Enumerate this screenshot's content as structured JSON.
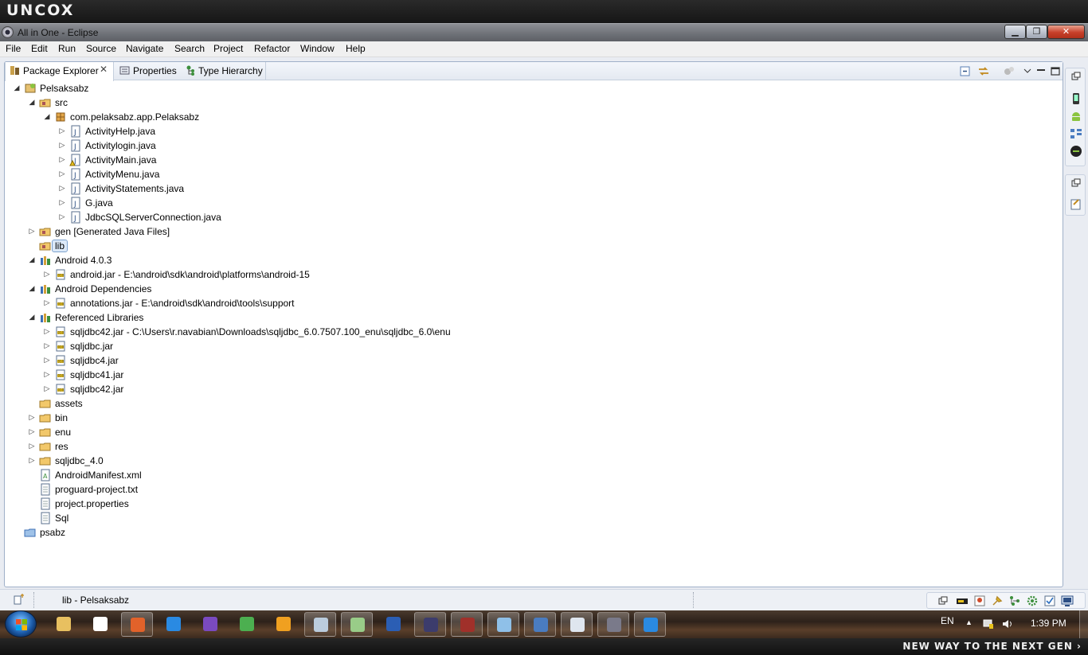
{
  "brand": {
    "logo": "UNCOX",
    "slogan": "NEW WAY TO THE NEXT GEN ›"
  },
  "window": {
    "title": "All in One - Eclipse",
    "controls": {
      "minimize": "▁",
      "maximize": "❐",
      "close": "✕"
    }
  },
  "menu": [
    "File",
    "Edit",
    "Run",
    "Source",
    "Navigate",
    "Search",
    "Project",
    "Refactor",
    "Window",
    "Help"
  ],
  "tabs": {
    "package_explorer": "Package Explorer",
    "close": "✕",
    "properties": "Properties",
    "type_hierarchy": "Type Hierarchy"
  },
  "tree": [
    {
      "label": "Pelsaksabz",
      "twisty": "◢",
      "icon": "android-project-icon"
    },
    {
      "label": "src",
      "twisty": "◢",
      "icon": "source-folder-icon"
    },
    {
      "label": "com.pelaksabz.app.Pelaksabz",
      "twisty": "◢",
      "icon": "package-icon"
    },
    {
      "label": "ActivityHelp.java",
      "twisty": "▷",
      "icon": "java-file-icon"
    },
    {
      "label": "Activitylogin.java",
      "twisty": "▷",
      "icon": "java-file-icon"
    },
    {
      "label": "ActivityMain.java",
      "twisty": "▷",
      "icon": "java-file-warning-icon"
    },
    {
      "label": "ActivityMenu.java",
      "twisty": "▷",
      "icon": "java-file-icon"
    },
    {
      "label": "ActivityStatements.java",
      "twisty": "▷",
      "icon": "java-file-icon"
    },
    {
      "label": "G.java",
      "twisty": "▷",
      "icon": "java-file-icon"
    },
    {
      "label": "JdbcSQLServerConnection.java",
      "twisty": "▷",
      "icon": "java-file-icon"
    },
    {
      "label": "gen [Generated Java Files]",
      "twisty": "▷",
      "icon": "source-folder-icon"
    },
    {
      "label": "lib",
      "twisty": "",
      "icon": "source-folder-icon"
    },
    {
      "label": "Android 4.0.3",
      "twisty": "◢",
      "icon": "library-icon"
    },
    {
      "label": "android.jar - E:\\android\\sdk\\android\\platforms\\android-15",
      "twisty": "▷",
      "icon": "jar-icon"
    },
    {
      "label": "Android Dependencies",
      "twisty": "◢",
      "icon": "library-icon"
    },
    {
      "label": "annotations.jar - E:\\android\\sdk\\android\\tools\\support",
      "twisty": "▷",
      "icon": "jar-icon"
    },
    {
      "label": "Referenced Libraries",
      "twisty": "◢",
      "icon": "library-icon"
    },
    {
      "label": "sqljdbc42.jar - C:\\Users\\r.navabian\\Downloads\\sqljdbc_6.0.7507.100_enu\\sqljdbc_6.0\\enu",
      "twisty": "▷",
      "icon": "jar-icon"
    },
    {
      "label": "sqljdbc.jar",
      "twisty": "▷",
      "icon": "jar-icon"
    },
    {
      "label": "sqljdbc4.jar",
      "twisty": "▷",
      "icon": "jar-icon"
    },
    {
      "label": "sqljdbc41.jar",
      "twisty": "▷",
      "icon": "jar-icon"
    },
    {
      "label": "sqljdbc42.jar",
      "twisty": "▷",
      "icon": "jar-icon"
    },
    {
      "label": "assets",
      "twisty": "",
      "icon": "folder-icon"
    },
    {
      "label": "bin",
      "twisty": "▷",
      "icon": "folder-icon"
    },
    {
      "label": "enu",
      "twisty": "▷",
      "icon": "folder-icon"
    },
    {
      "label": "res",
      "twisty": "▷",
      "icon": "folder-icon"
    },
    {
      "label": "sqljdbc_4.0",
      "twisty": "▷",
      "icon": "folder-icon"
    },
    {
      "label": "AndroidManifest.xml",
      "twisty": "",
      "icon": "xml-file-icon"
    },
    {
      "label": "proguard-project.txt",
      "twisty": "",
      "icon": "text-file-icon"
    },
    {
      "label": "project.properties",
      "twisty": "",
      "icon": "text-file-icon"
    },
    {
      "label": "Sql",
      "twisty": "",
      "icon": "text-file-icon"
    },
    {
      "label": "psabz",
      "twisty": "",
      "icon": "closed-project-icon"
    }
  ],
  "status": {
    "text": "lib - Pelsaksabz"
  },
  "taskbar": {
    "lang": "EN",
    "clock": "1:39 PM",
    "tray_arrow": "▲",
    "apps": [
      "explorer-icon",
      "snipping-icon",
      "firefox-icon",
      "ie-icon",
      "visual-studio-icon",
      "chrome-icon",
      "media-player-icon",
      "notepad-icon",
      "paint-icon",
      "word-icon",
      "eclipse-icon",
      "winrar-icon",
      "windows-explorer-icon",
      "remote-desktop-icon",
      "console-icon",
      "eclipse-active-icon",
      "edge-icon"
    ]
  },
  "colors": {
    "selection": "#dce9f8",
    "selection_border": "#7da2ce",
    "view_border": "#9fb0c8"
  }
}
